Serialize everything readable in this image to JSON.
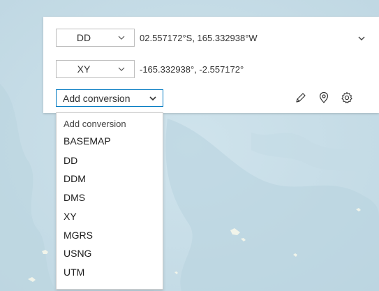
{
  "colors": {
    "accent": "#0079c1",
    "map_water": "#c9dfe8",
    "panel": "#ffffff"
  },
  "converter": {
    "rows": [
      {
        "format": "DD",
        "value": "02.557172°S, 165.332938°W"
      },
      {
        "format": "XY",
        "value": "-165.332938°, -2.557172°"
      }
    ],
    "expand_icon": "chevron-down-icon",
    "add_conversion": {
      "label": "Add conversion"
    },
    "tools": [
      "pencil-icon",
      "map-pin-icon",
      "gear-icon"
    ]
  },
  "dropdown": {
    "options": [
      "Add conversion",
      "BASEMAP",
      "DD",
      "DDM",
      "DMS",
      "XY",
      "MGRS",
      "USNG",
      "UTM"
    ]
  }
}
